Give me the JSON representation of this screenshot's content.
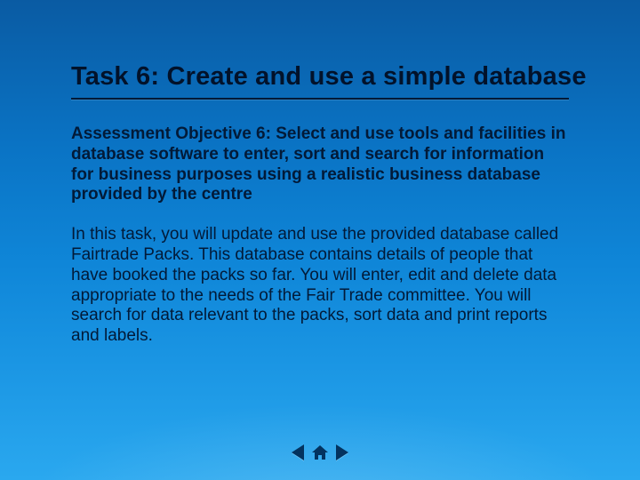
{
  "slide": {
    "title": "Task 6: Create and use a simple database",
    "objective": "Assessment Objective 6: Select and use tools and facilities in database software to enter, sort and search for information for business purposes using a realistic business database provided by the centre",
    "description": "In this task, you will update and use the provided database called Fairtrade Packs. This database contains details of people that have booked the packs so far. You will enter, edit and delete data appropriate to the needs of the Fair Trade committee. You will search for data relevant to the packs, sort data and print reports and labels."
  },
  "nav": {
    "prev": "Previous",
    "home": "Home",
    "next": "Next"
  },
  "colors": {
    "bg_top": "#0a5ba3",
    "bg_bottom": "#2aa8ef",
    "text": "#021a38"
  }
}
